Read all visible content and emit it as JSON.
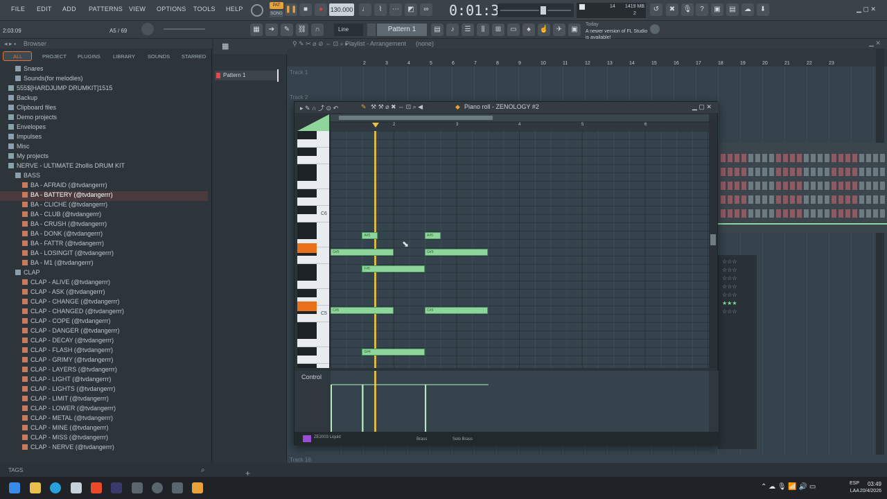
{
  "menu": {
    "items": [
      "FILE",
      "EDIT",
      "ADD",
      "PATTERNS",
      "VIEW",
      "OPTIONS",
      "TOOLS",
      "HELP"
    ]
  },
  "transport": {
    "tempo": "130.000",
    "time": "0:01:32",
    "pat_label": "PAT",
    "song_label": "SONG",
    "cpu": "14",
    "mem": "1419 MB",
    "mem2": "2"
  },
  "status": {
    "position": "2:03:09",
    "count": "A5 / 69"
  },
  "toolbar2": {
    "mode": "Line",
    "pattern": "Pattern 1",
    "hint_date": "Today",
    "hint_text": "A newer version of FL Studio is available!"
  },
  "browser": {
    "title": "Browser",
    "tabs": [
      "ALL",
      "PROJECT",
      "PLUGINS",
      "LIBRARY",
      "SOUNDS",
      "STARRED"
    ],
    "items": [
      {
        "label": "Snares",
        "indent": 1,
        "type": "folder"
      },
      {
        "label": "Sounds(for melodies)",
        "indent": 1,
        "type": "folder"
      },
      {
        "label": "555$[HARDJUMP DRUMKIT]1515",
        "indent": 0,
        "type": "folder"
      },
      {
        "label": "Backup",
        "indent": 0,
        "type": "folder"
      },
      {
        "label": "Clipboard files",
        "indent": 0,
        "type": "folder"
      },
      {
        "label": "Demo projects",
        "indent": 0,
        "type": "folder"
      },
      {
        "label": "Envelopes",
        "indent": 0,
        "type": "folder"
      },
      {
        "label": "Impulses",
        "indent": 0,
        "type": "folder"
      },
      {
        "label": "Misc",
        "indent": 0,
        "type": "folder"
      },
      {
        "label": "My projects",
        "indent": 0,
        "type": "folder"
      },
      {
        "label": "NERVE - ULTIMATE 2hollis DRUM KIT",
        "indent": 0,
        "type": "folder-open"
      },
      {
        "label": "BASS",
        "indent": 1,
        "type": "folder-open"
      },
      {
        "label": "BA - AFRAID (@tvdangerrr)",
        "indent": 2,
        "type": "file"
      },
      {
        "label": "BA - BATTERY (@tvdangerrr)",
        "indent": 2,
        "type": "file-selected"
      },
      {
        "label": "BA - CLICHE (@tvdangerrr)",
        "indent": 2,
        "type": "file"
      },
      {
        "label": "BA - CLUB (@tvdangerrr)",
        "indent": 2,
        "type": "file"
      },
      {
        "label": "BA - CRUSH (@tvdangerrr)",
        "indent": 2,
        "type": "file"
      },
      {
        "label": "BA - DONK (@tvdangerrr)",
        "indent": 2,
        "type": "file"
      },
      {
        "label": "BA - FATTR (@tvdangerrr)",
        "indent": 2,
        "type": "file"
      },
      {
        "label": "BA - LOSINGIT (@tvdangerrr)",
        "indent": 2,
        "type": "file"
      },
      {
        "label": "BA - M1 (@tvdangerrr)",
        "indent": 2,
        "type": "file"
      },
      {
        "label": "CLAP",
        "indent": 1,
        "type": "folder-open"
      },
      {
        "label": "CLAP - ALIVE (@tvdangerrr)",
        "indent": 2,
        "type": "file"
      },
      {
        "label": "CLAP - ASK (@tvdangerrr)",
        "indent": 2,
        "type": "file"
      },
      {
        "label": "CLAP - CHANGE (@tvdangerrr)",
        "indent": 2,
        "type": "file"
      },
      {
        "label": "CLAP - CHANGED (@tvdangerrr)",
        "indent": 2,
        "type": "file"
      },
      {
        "label": "CLAP - COPE (@tvdangerrr)",
        "indent": 2,
        "type": "file"
      },
      {
        "label": "CLAP - DANGER (@tvdangerrr)",
        "indent": 2,
        "type": "file"
      },
      {
        "label": "CLAP - DECAY (@tvdangerrr)",
        "indent": 2,
        "type": "file"
      },
      {
        "label": "CLAP - FLASH (@tvdangerrr)",
        "indent": 2,
        "type": "file"
      },
      {
        "label": "CLAP - GRIMY (@tvdangerrr)",
        "indent": 2,
        "type": "file"
      },
      {
        "label": "CLAP - LAYERS (@tvdangerrr)",
        "indent": 2,
        "type": "file"
      },
      {
        "label": "CLAP - LIGHT (@tvdangerrr)",
        "indent": 2,
        "type": "file"
      },
      {
        "label": "CLAP - LIGHTS (@tvdangerrr)",
        "indent": 2,
        "type": "file"
      },
      {
        "label": "CLAP - LIMIT (@tvdangerrr)",
        "indent": 2,
        "type": "file"
      },
      {
        "label": "CLAP - LOWER (@tvdangerrr)",
        "indent": 2,
        "type": "file"
      },
      {
        "label": "CLAP - METAL (@tvdangerrr)",
        "indent": 2,
        "type": "file"
      },
      {
        "label": "CLAP - MINE (@tvdangerrr)",
        "indent": 2,
        "type": "file"
      },
      {
        "label": "CLAP - MISS (@tvdangerrr)",
        "indent": 2,
        "type": "file"
      },
      {
        "label": "CLAP - NERVE (@tvdangerrr)",
        "indent": 2,
        "type": "file"
      }
    ],
    "footer": "TAGS"
  },
  "channel": {
    "pattern": "Pattern 1"
  },
  "playlist": {
    "title": "Playlist - Arrangement",
    "sub": "(none)",
    "tracks": [
      "Track 1",
      "Track 2",
      "Track 16"
    ],
    "ruler": [
      "2",
      "3",
      "4",
      "5",
      "6",
      "7",
      "8",
      "9",
      "10",
      "11",
      "12",
      "13",
      "14",
      "15",
      "16",
      "17",
      "18",
      "19",
      "20",
      "21",
      "22",
      "23"
    ]
  },
  "pianoroll": {
    "title": "Piano roll - ZENOLOGY #2",
    "control": "Control",
    "key_c6": "C6",
    "key_c5": "C5",
    "bars": [
      "2",
      "3",
      "4",
      "5",
      "6"
    ],
    "notes": [
      {
        "label": "A#5",
        "start": 1.5,
        "len": 0.25,
        "row": 0
      },
      {
        "label": "A#5",
        "start": 2.5,
        "len": 0.25,
        "row": 0
      },
      {
        "label": "G#5",
        "start": 1.0,
        "len": 1.0,
        "row": 1
      },
      {
        "label": "G#5",
        "start": 2.5,
        "len": 1.0,
        "row": 1
      },
      {
        "label": "F#5",
        "start": 1.5,
        "len": 1.0,
        "row": 2
      },
      {
        "label": "C#5",
        "start": 1.0,
        "len": 1.0,
        "row": 3
      },
      {
        "label": "C#5",
        "start": 2.5,
        "len": 1.0,
        "row": 3
      },
      {
        "label": "G#4",
        "start": 1.5,
        "len": 1.0,
        "row": 4
      }
    ],
    "footer_labels": [
      "ZE2003 Liquid",
      "Brass",
      "Solo Brass"
    ]
  },
  "taskbar": {
    "lang": "ESP",
    "lang2": "LAA",
    "time": "03:49",
    "date": "20/4/2026"
  }
}
